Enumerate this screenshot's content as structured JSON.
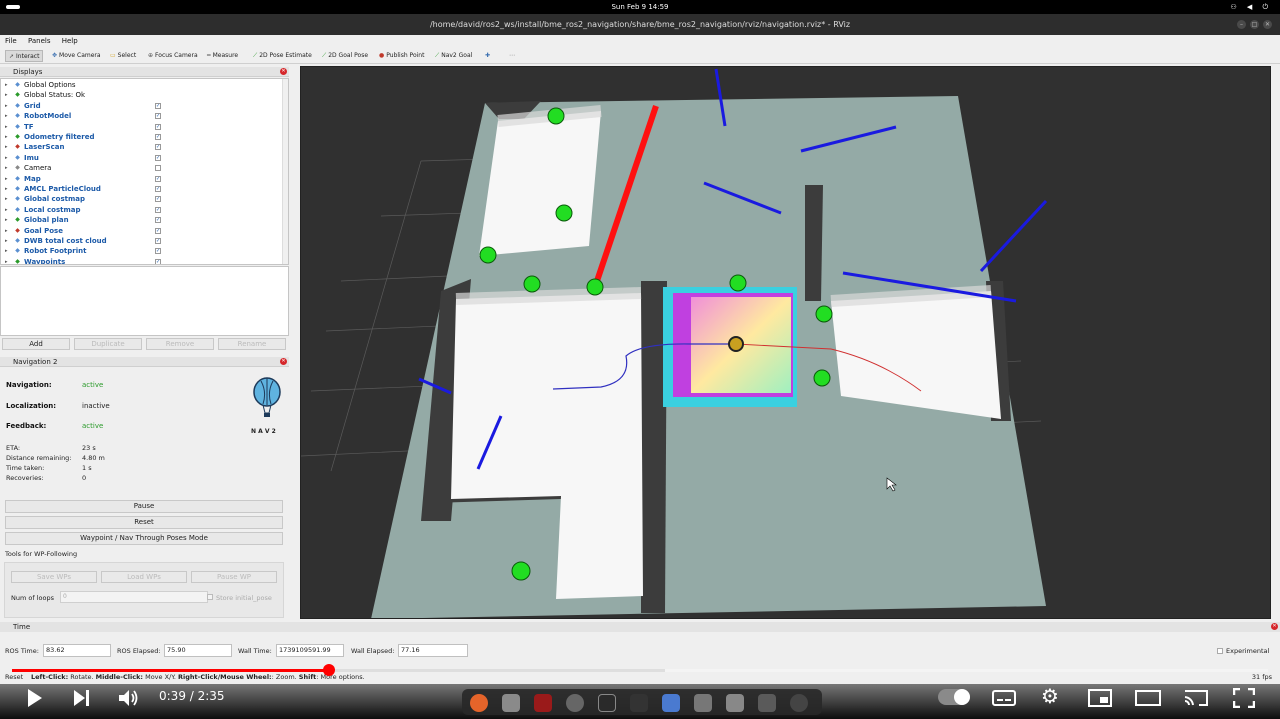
{
  "system_bar": {
    "clock": "Sun Feb 9  14:59"
  },
  "window": {
    "title": "/home/david/ros2_ws/install/bme_ros2_navigation/share/bme_ros2_navigation/rviz/navigation.rviz* - RViz"
  },
  "menu": [
    "File",
    "Panels",
    "Help"
  ],
  "toolbar": [
    {
      "label": "Interact",
      "icon": "interact-icon"
    },
    {
      "label": "Move Camera",
      "icon": "move-camera-icon"
    },
    {
      "label": "Select",
      "icon": "select-icon"
    },
    {
      "label": "Focus Camera",
      "icon": "focus-camera-icon"
    },
    {
      "label": "Measure",
      "icon": "measure-icon"
    },
    {
      "label": "2D Pose Estimate",
      "icon": "pose-estimate-icon"
    },
    {
      "label": "2D Goal Pose",
      "icon": "goal-pose-icon"
    },
    {
      "label": "Publish Point",
      "icon": "publish-point-icon"
    },
    {
      "label": "Nav2 Goal",
      "icon": "nav2-goal-icon"
    }
  ],
  "displays": {
    "header": "Displays",
    "items": [
      {
        "label": "Global Options",
        "checked": null,
        "bold": false,
        "icon_color": "#5a8fd0"
      },
      {
        "label": "Global Status: Ok",
        "checked": null,
        "bold": false,
        "icon_color": "#2a9a2a"
      },
      {
        "label": "Grid",
        "checked": true,
        "bold": true,
        "icon_color": "#5a8fd0"
      },
      {
        "label": "RobotModel",
        "checked": true,
        "bold": true,
        "icon_color": "#5a8fd0"
      },
      {
        "label": "TF",
        "checked": true,
        "bold": true,
        "icon_color": "#5a8fd0"
      },
      {
        "label": "Odometry filtered",
        "checked": true,
        "bold": true,
        "icon_color": "#2a9a2a"
      },
      {
        "label": "LaserScan",
        "checked": true,
        "bold": true,
        "icon_color": "#c0392b"
      },
      {
        "label": "Imu",
        "checked": true,
        "bold": true,
        "icon_color": "#5a8fd0"
      },
      {
        "label": "Camera",
        "checked": false,
        "bold": false,
        "icon_color": "#888888"
      },
      {
        "label": "Map",
        "checked": true,
        "bold": true,
        "icon_color": "#5a8fd0"
      },
      {
        "label": "AMCL ParticleCloud",
        "checked": true,
        "bold": true,
        "icon_color": "#5a8fd0"
      },
      {
        "label": "Global costmap",
        "checked": true,
        "bold": true,
        "icon_color": "#5a8fd0"
      },
      {
        "label": "Local costmap",
        "checked": true,
        "bold": true,
        "icon_color": "#5a8fd0"
      },
      {
        "label": "Global plan",
        "checked": true,
        "bold": true,
        "icon_color": "#2a9a2a"
      },
      {
        "label": "Goal Pose",
        "checked": true,
        "bold": true,
        "icon_color": "#c0392b"
      },
      {
        "label": "DWB total cost cloud",
        "checked": true,
        "bold": true,
        "icon_color": "#5a8fd0"
      },
      {
        "label": "Robot Footprint",
        "checked": true,
        "bold": true,
        "icon_color": "#5a8fd0"
      },
      {
        "label": "Waypoints",
        "checked": true,
        "bold": true,
        "icon_color": "#2a9a2a"
      }
    ],
    "buttons": [
      "Add",
      "Duplicate",
      "Remove",
      "Rename"
    ]
  },
  "navigation": {
    "header": "Navigation 2",
    "logo_text": "N A V 2",
    "navigation_label": "Navigation:",
    "navigation_value": "active",
    "localization_label": "Localization:",
    "localization_value": "inactive",
    "feedback_label": "Feedback:",
    "feedback_value": "active",
    "eta_label": "ETA:",
    "eta_value": "23 s",
    "distance_label": "Distance remaining:",
    "distance_value": "4.80 m",
    "time_label": "Time taken:",
    "time_value": "1 s",
    "recoveries_label": "Recoveries:",
    "recoveries_value": "0",
    "pause_button": "Pause",
    "reset_button": "Reset",
    "waypoint_button": "Waypoint / Nav Through Poses Mode",
    "wp_tools_label": "Tools for WP-Following",
    "save_wps": "Save WPs",
    "load_wps": "Load WPs",
    "pause_wp": "Pause WP",
    "loops_label": "Num of loops",
    "loops_value": "0",
    "store_initial_pose": "Store initial_pose"
  },
  "time_panel": {
    "header": "Time",
    "ros_time_label": "ROS Time:",
    "ros_time": "83.62",
    "ros_elapsed_label": "ROS Elapsed:",
    "ros_elapsed": "75.90",
    "wall_time_label": "Wall Time:",
    "wall_time": "1739109591.99",
    "wall_elapsed_label": "Wall Elapsed:",
    "wall_elapsed": "77.16",
    "experimental_label": "Experimental"
  },
  "status_bar": {
    "reset": "Reset",
    "hint_b1": "Left-Click:",
    "hint_t1": " Rotate. ",
    "hint_b2": "Middle-Click:",
    "hint_t2": " Move X/Y. ",
    "hint_b3": "Right-Click/Mouse Wheel:",
    "hint_t3": ": Zoom. ",
    "hint_b4": "Shift",
    "hint_t4": ": More options.",
    "fps": "31 fps"
  },
  "player": {
    "time": "0:39 / 2:35",
    "played_fraction": 0.252,
    "buffered_fraction": 0.52
  },
  "colors": {
    "accent_red": "#ff0000",
    "rviz_blue": "#1c5aa8",
    "active_green": "#2a9a2a"
  }
}
